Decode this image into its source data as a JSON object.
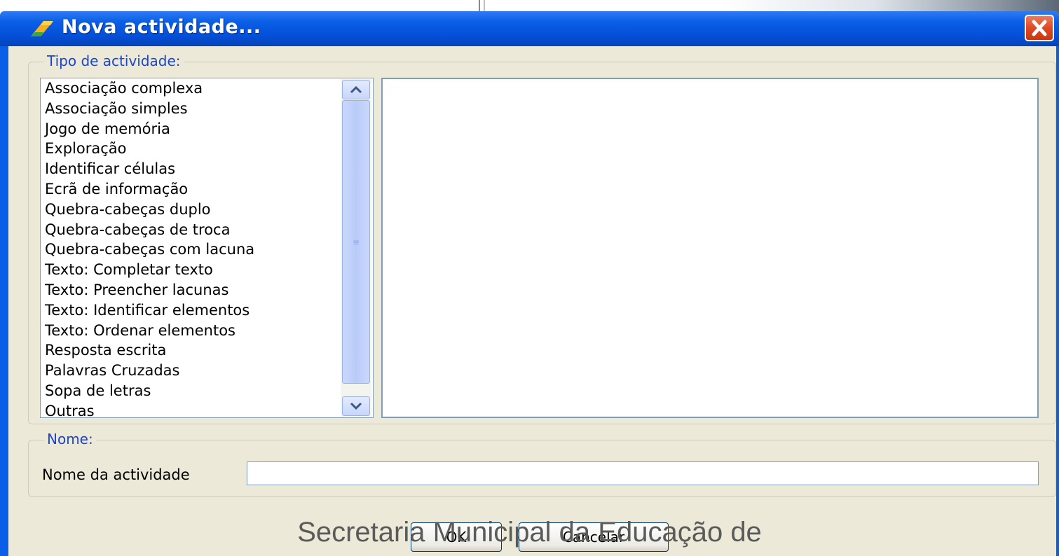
{
  "dialog": {
    "title": "Nova actividade...",
    "app_icon": "jclic-author-icon",
    "close_icon": "close-icon"
  },
  "activity_type": {
    "legend": "Tipo de actividade:",
    "items": [
      "Associação complexa",
      "Associação simples",
      "Jogo de memória",
      "Exploração",
      "Identificar células",
      "Ecrã de informação",
      "Quebra-cabeças duplo",
      "Quebra-cabeças de troca",
      "Quebra-cabeças com lacuna",
      "Texto: Completar texto",
      "Texto: Preencher lacunas",
      "Texto: Identificar elementos",
      "Texto: Ordenar elementos",
      "Resposta escrita",
      "Palavras Cruzadas",
      "Sopa de letras",
      "Outras"
    ]
  },
  "name_group": {
    "legend": "Nome:",
    "label": "Nome da actividade",
    "value": ""
  },
  "buttons": {
    "ok": "OK",
    "cancel": "Cancelar"
  },
  "footer_overlay": "Secretaria Municipal da Educação de",
  "colors": {
    "titlebar": "#0a5fe6",
    "legend_text": "#1c46c8",
    "dialog_bg": "#ece9d8",
    "close_button": "#de4a25"
  }
}
